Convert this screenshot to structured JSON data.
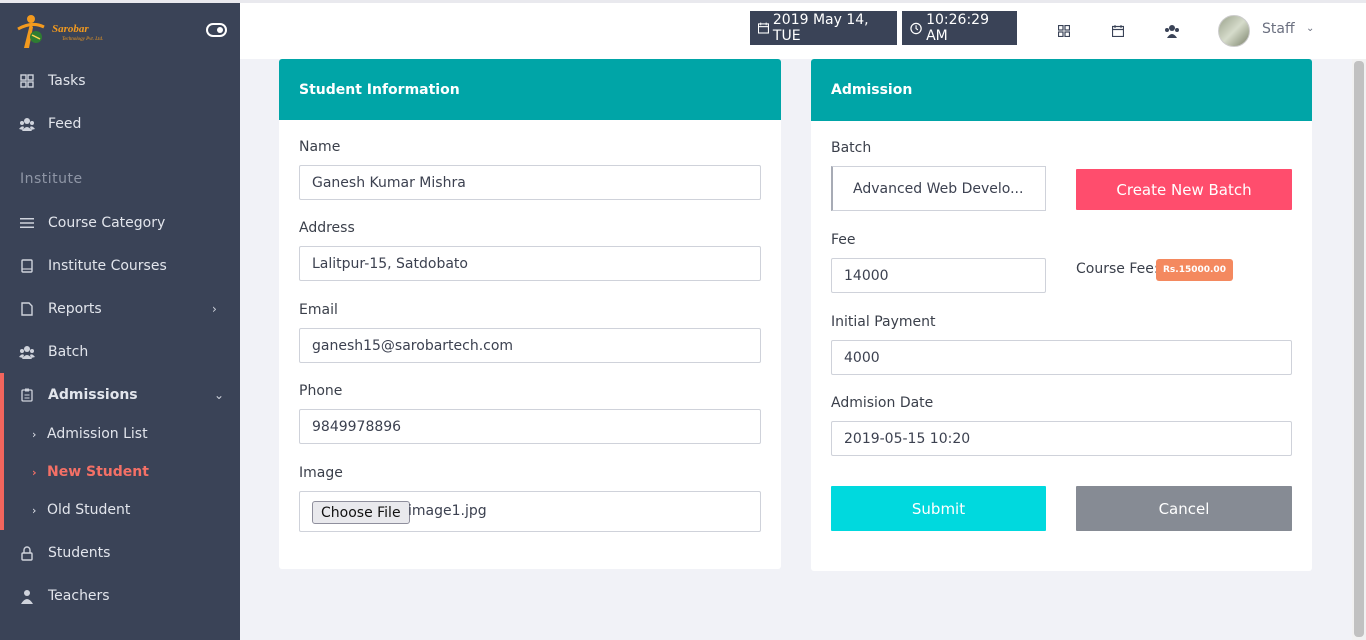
{
  "brand": {
    "name": "Sarobar",
    "sub": "Technology Pvt. Ltd."
  },
  "sidebar": {
    "items": [
      {
        "label": "Tasks"
      },
      {
        "label": "Feed"
      },
      {
        "label": "Course Category"
      },
      {
        "label": "Institute Courses"
      },
      {
        "label": "Reports"
      },
      {
        "label": "Batch"
      },
      {
        "label": "Admissions"
      },
      {
        "label": "Students"
      },
      {
        "label": "Teachers"
      }
    ],
    "section": "Institute",
    "admissions_sub": [
      {
        "label": "Admission List"
      },
      {
        "label": "New Student"
      },
      {
        "label": "Old Student"
      }
    ]
  },
  "header": {
    "date": "2019 May 14, TUE",
    "time": "10:26:29 AM",
    "user": "Staff"
  },
  "student_info": {
    "title": "Student Information",
    "name_label": "Name",
    "name_value": "Ganesh Kumar Mishra",
    "address_label": "Address",
    "address_value": "Lalitpur-15, Satdobato",
    "email_label": "Email",
    "email_value": "ganesh15@sarobartech.com",
    "phone_label": "Phone",
    "phone_value": "9849978896",
    "image_label": "Image",
    "file_button": "Choose File",
    "file_name": "image1.jpg"
  },
  "admission": {
    "title": "Admission",
    "batch_label": "Batch",
    "batch_value": "Advanced Web Develo...",
    "create_batch_button": "Create New Batch",
    "fee_label": "Fee",
    "fee_value": "14000",
    "course_fee_label": "Course Fee:",
    "course_fee_badge": "Rs.15000.00",
    "initial_payment_label": "Initial Payment",
    "initial_payment_value": "4000",
    "date_label": "Admision Date",
    "date_value": "2019-05-15 10:20",
    "submit_button": "Submit",
    "cancel_button": "Cancel"
  },
  "colors": {
    "sidebar": "#3a4357",
    "teal": "#00a5a7",
    "create": "#ff4d6d",
    "submit": "#00d9de",
    "cancel": "#868b94",
    "active": "#f47066",
    "badge": "#f4895f"
  }
}
